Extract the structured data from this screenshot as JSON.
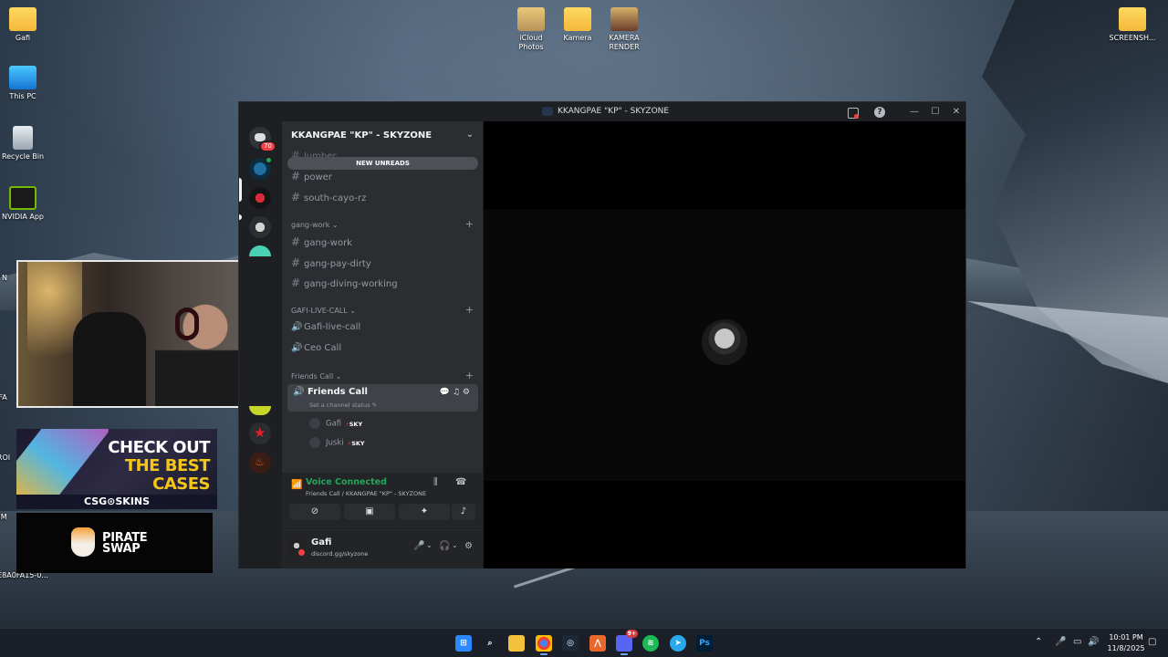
{
  "desktop": {
    "icons": [
      {
        "label": "Gafi"
      },
      {
        "label": "This PC"
      },
      {
        "label": "Recycle Bin"
      },
      {
        "label": "NVIDIA App"
      },
      {
        "label": "iCloud Photos"
      },
      {
        "label": "Kamera"
      },
      {
        "label": "KAMERA RENDER"
      },
      {
        "label": "SCREENSH..."
      },
      {
        "label": "E8A0FA15-0..."
      }
    ],
    "partial_labels": [
      "N",
      "FA",
      "ROI",
      "IM"
    ]
  },
  "overlays": {
    "ad_case_line1": "CHECK OUT",
    "ad_case_line2": "THE BEST",
    "ad_case_line3": "CASES",
    "ad_case_brand": "CSG⊙SKINS",
    "ad_swap_line1": "PIRATE",
    "ad_swap_line2": "SWAP"
  },
  "window": {
    "title": "KKANGPAE \"KP\" - SKYZONE",
    "minimize": "—",
    "maximize": "☐",
    "close": "✕"
  },
  "guilds": {
    "dm_badge": "70",
    "star_glyph": "★",
    "flame_glyph": "♨"
  },
  "server": {
    "name": "KKANGPAE \"KP\" - SKYZONE",
    "chevron": "⌄",
    "new_unreads": "NEW UNREADS",
    "top_partial": "lumber",
    "channels_top": [
      "power",
      "south-cayo-rz"
    ],
    "cat_gang": "gang-work",
    "gang_channels": [
      "gang-work",
      "gang-pay-dirty",
      "gang-diving-working"
    ],
    "cat_live": "GAFI-LIVE-CALL",
    "live_channels": [
      "Gafi-live-call",
      "Ceo Call"
    ],
    "cat_friends": "Friends Call",
    "active_channel": "Friends Call",
    "active_status": "Set a channel status ✎",
    "voice_users": [
      {
        "name": "Gafi",
        "tag": "SKY"
      },
      {
        "name": "Juski",
        "tag": "SKY"
      }
    ]
  },
  "voice": {
    "status": "Voice Connected",
    "location": "Friends Call / KKANGPAE \"KP\" - SKYZONE"
  },
  "user": {
    "name": "Gafi",
    "status": "discord.gg/skyzone"
  },
  "taskbar": {
    "time": "10:01 PM",
    "date": "11/8/2025",
    "discord_badge": "9+"
  },
  "colors": {
    "connected_green": "#23a55a",
    "danger_red": "#f23f43",
    "discord_bg": "#2b2d31"
  }
}
